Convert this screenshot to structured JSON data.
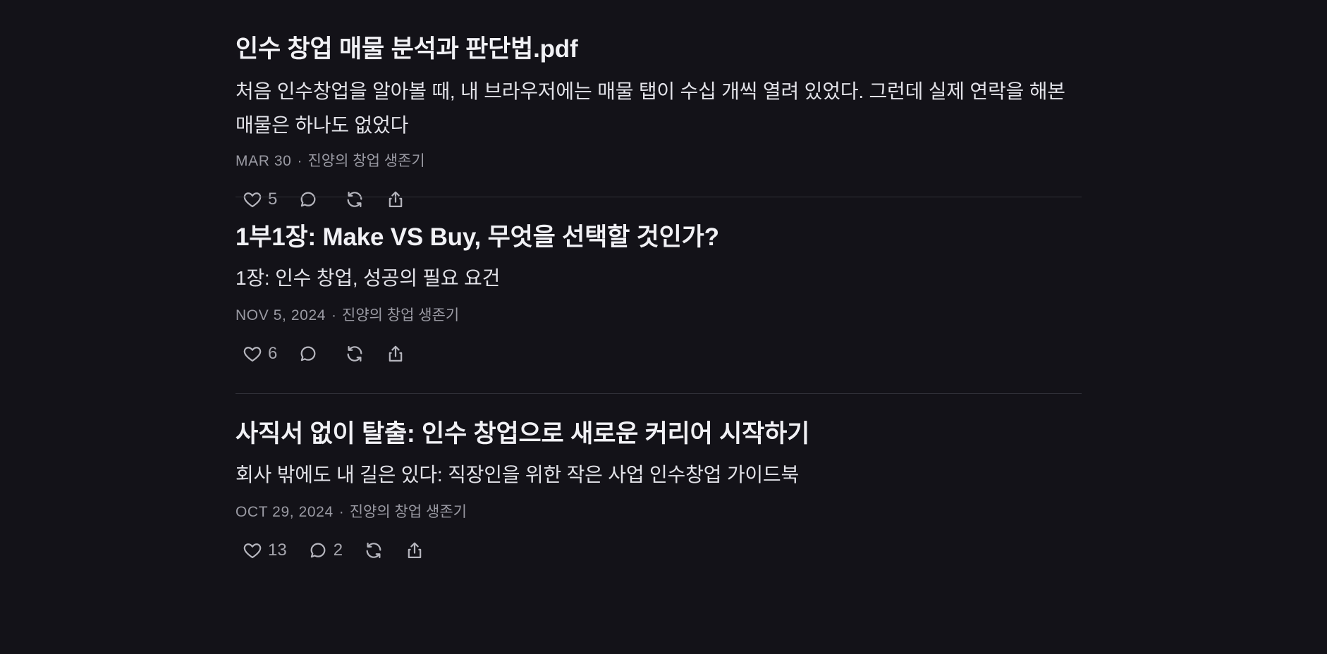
{
  "posts": [
    {
      "title": "인수 창업 매물 분석과 판단법.pdf",
      "subtitle": "처음 인수창업을 알아볼 때, 내 브라우저에는 매물 탭이 수십 개씩 열려 있었다. 그런데 실제 연락을 해본 매물은 하나도 없었다",
      "date": "MAR 30",
      "separator": "·",
      "publication": "진양의 창업 생존기",
      "likes": "5",
      "comments": ""
    },
    {
      "title": "1부1장: Make VS Buy, 무엇을 선택할 것인가?",
      "subtitle": "1장: 인수 창업, 성공의 필요 요건",
      "date": "NOV 5, 2024",
      "separator": "·",
      "publication": "진양의 창업 생존기",
      "likes": "6",
      "comments": ""
    },
    {
      "title": "사직서 없이 탈출: 인수 창업으로 새로운 커리어 시작하기",
      "subtitle": "회사 밖에도 내 길은 있다: 직장인을 위한 작은 사업 인수창업 가이드북",
      "date": "OCT 29, 2024",
      "separator": "·",
      "publication": "진양의 창업 생존기",
      "likes": "13",
      "comments": "2"
    }
  ],
  "icons": {
    "like": "heart-icon",
    "comment": "comment-bubble-icon",
    "restack": "restack-icon",
    "share": "share-icon"
  },
  "colors": {
    "background": "#131218",
    "title": "#f1f1f5",
    "meta": "#9a9aa3",
    "divider": "#303038"
  }
}
